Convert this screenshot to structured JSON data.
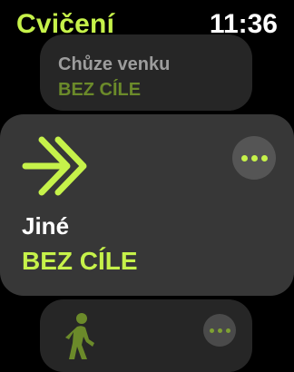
{
  "header": {
    "title": "Cvičení",
    "time": "11:36"
  },
  "colors": {
    "accent": "#c6f24a",
    "card": "#373737",
    "card_dim": "#262626"
  },
  "workouts": [
    {
      "name": "Chůze venku",
      "goal": "BEZ CÍLE",
      "icon": "walking-person-icon"
    },
    {
      "name": "Jiné",
      "goal": "BEZ CÍLE",
      "icon": "double-chevron-right-icon",
      "more_icon": "more-options-icon"
    },
    {
      "name": "",
      "goal": "",
      "icon": "walking-person-icon",
      "more_icon": "more-options-icon"
    }
  ]
}
